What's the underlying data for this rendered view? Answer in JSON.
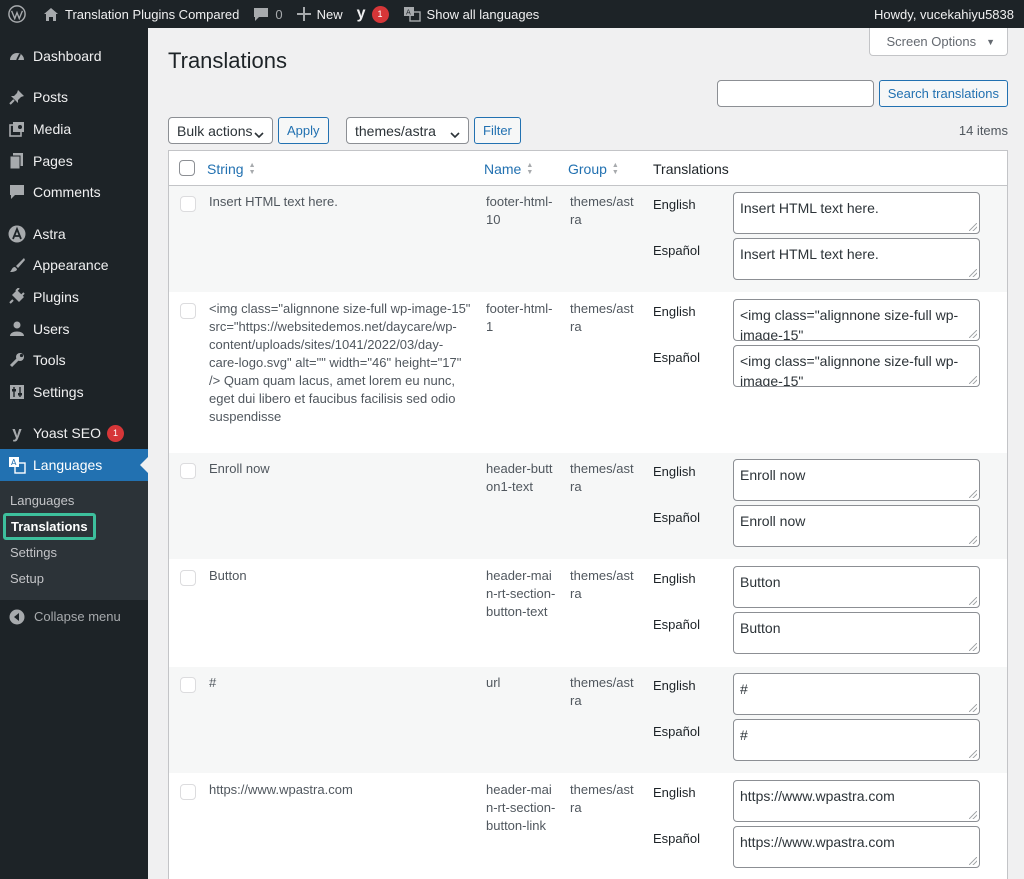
{
  "adminbar": {
    "site_name": "Translation Plugins Compared",
    "comments_count": "0",
    "new_label": "New",
    "yoast_count": "1",
    "languages_label": "Show all languages",
    "howdy": "Howdy, vucekahiyu5838"
  },
  "sidebar": {
    "items": [
      {
        "label": "Dashboard",
        "icon": "dashboard-icon"
      },
      {
        "label": "Posts",
        "icon": "pushpin-icon"
      },
      {
        "label": "Media",
        "icon": "media-icon"
      },
      {
        "label": "Pages",
        "icon": "pages-icon"
      },
      {
        "label": "Comments",
        "icon": "comments-icon"
      },
      {
        "label": "Astra",
        "icon": "astra-icon"
      },
      {
        "label": "Appearance",
        "icon": "brush-icon"
      },
      {
        "label": "Plugins",
        "icon": "plugin-icon"
      },
      {
        "label": "Users",
        "icon": "users-icon"
      },
      {
        "label": "Tools",
        "icon": "wrench-icon"
      },
      {
        "label": "Settings",
        "icon": "settings-icon"
      },
      {
        "label": "Yoast SEO",
        "icon": "yoast-icon",
        "badge": "1"
      },
      {
        "label": "Languages",
        "icon": "translate-icon"
      }
    ],
    "submenu": [
      "Languages",
      "Translations",
      "Settings",
      "Setup"
    ],
    "collapse": "Collapse menu"
  },
  "page": {
    "screen_options": "Screen Options",
    "title": "Translations",
    "search_button": "Search translations",
    "search_value": "",
    "bulk_actions": "Bulk actions",
    "apply": "Apply",
    "group_filter": "themes/astra",
    "filter": "Filter",
    "items_count": "14 items"
  },
  "table": {
    "columns": {
      "string": "String",
      "name": "Name",
      "group": "Group",
      "translations": "Translations"
    },
    "rows": [
      {
        "string": "Insert HTML text here.",
        "name": "footer-html-10",
        "group": "themes/astra",
        "en_label": "English",
        "es_label": "Español",
        "en": "Insert HTML text here.",
        "es": "Insert HTML text here."
      },
      {
        "string": "<img class=\"alignnone size-full wp-image-15\" src=\"https://websitedemos.net/daycare/wp-content/uploads/sites/1041/2022/03/day-care-logo.svg\" alt=\"\" width=\"46\" height=\"17\" /> Quam quam lacus, amet lorem eu nunc, eget dui libero et faucibus facilisis sed odio suspendisse",
        "name": "footer-html-1",
        "group": "themes/astra",
        "en_label": "English",
        "es_label": "Español",
        "en": "<img class=\"alignnone size-full wp-image-15\"",
        "es": "<img class=\"alignnone size-full wp-image-15\""
      },
      {
        "string": "Enroll now",
        "name": "header-button1-text",
        "group": "themes/astra",
        "en_label": "English",
        "es_label": "Español",
        "en": "Enroll now",
        "es": "Enroll now"
      },
      {
        "string": "Button",
        "name": "header-main-rt-section-button-text",
        "group": "themes/astra",
        "en_label": "English",
        "es_label": "Español",
        "en": "Button",
        "es": "Button"
      },
      {
        "string": "#",
        "name": "url",
        "group": "themes/astra",
        "en_label": "English",
        "es_label": "Español",
        "en": "#",
        "es": "#"
      },
      {
        "string": "https://www.wpastra.com",
        "name": "header-main-rt-section-button-link",
        "group": "themes/astra",
        "en_label": "English",
        "es_label": "Español",
        "en": "https://www.wpastra.com",
        "es": "https://www.wpastra.com"
      }
    ]
  }
}
